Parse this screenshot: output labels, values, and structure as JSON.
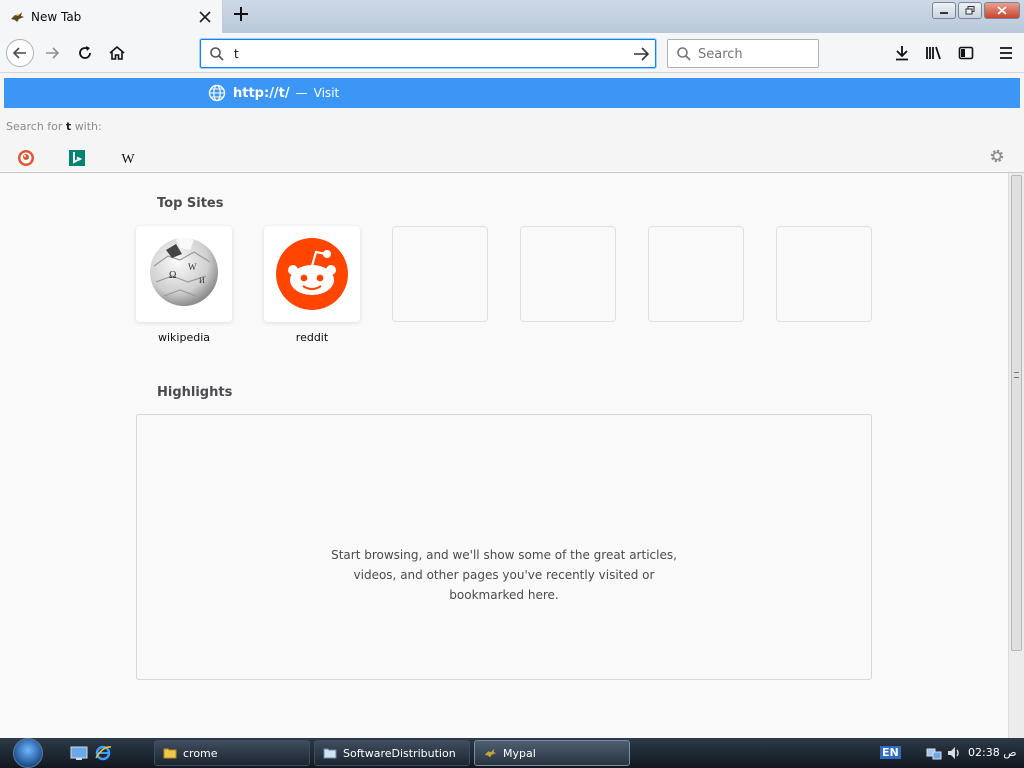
{
  "browser": {
    "tab": {
      "title": "New Tab"
    },
    "url_input": {
      "value": "t"
    },
    "search_bar": {
      "placeholder": "Search"
    },
    "autocomplete": {
      "suggestion_url": "http://t/",
      "separator": "—",
      "suggestion_action": "Visit",
      "search_with_prefix": "Search for",
      "search_with_term": "t",
      "search_with_suffix": "with:",
      "engines": [
        "duckduckgo-icon",
        "bing-icon",
        "wikipedia-icon"
      ]
    }
  },
  "newtab": {
    "top_sites_title": "Top Sites",
    "top_sites": [
      {
        "label": "wikipedia",
        "icon": "wikipedia-globe-icon"
      },
      {
        "label": "reddit",
        "icon": "reddit-alien-icon"
      },
      {
        "label": ""
      },
      {
        "label": ""
      },
      {
        "label": ""
      },
      {
        "label": ""
      }
    ],
    "highlights_title": "Highlights",
    "highlights_message_lines": [
      "Start browsing, and we'll show some of the great articles,",
      "videos, and other pages you've recently visited or",
      "bookmarked here."
    ]
  },
  "taskbar": {
    "tasks": [
      {
        "label": "crome"
      },
      {
        "label": "SoftwareDistribution"
      },
      {
        "label": "Mypal"
      }
    ],
    "language": "EN",
    "clock": "02:38 ص"
  },
  "colors": {
    "accent": "#0a84ff",
    "suggestion_highlight": "#3b96f5",
    "reddit": "#ff4500"
  }
}
